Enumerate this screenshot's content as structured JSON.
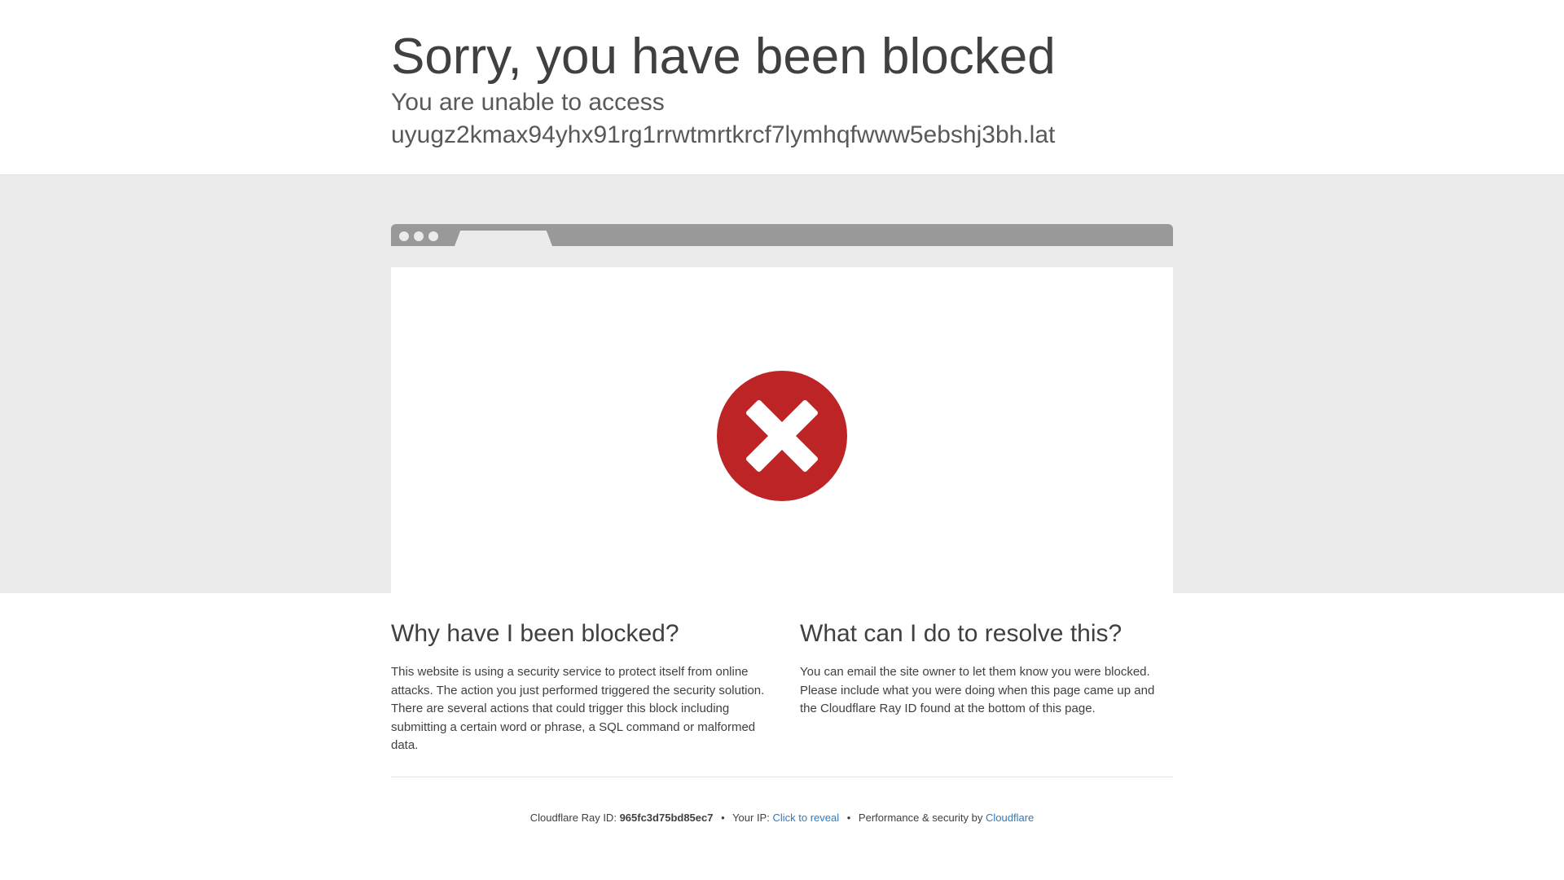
{
  "header": {
    "title": "Sorry, you have been blocked",
    "subtitle_line1": "You are unable to access",
    "subtitle_line2": "uyugz2kmax94yhx91rg1rrwtmrtkrcf7lymhqfwww5ebshj3bh.lat"
  },
  "illustration": {
    "icon": "blocked-x-icon",
    "icon_color": "#bd2426"
  },
  "why": {
    "heading": "Why have I been blocked?",
    "body": "This website is using a security service to protect itself from online attacks. The action you just performed triggered the security solution. There are several actions that could trigger this block including submitting a certain word or phrase, a SQL command or malformed data."
  },
  "resolve": {
    "heading": "What can I do to resolve this?",
    "body": "You can email the site owner to let them know you were blocked. Please include what you were doing when this page came up and the Cloudflare Ray ID found at the bottom of this page."
  },
  "footer": {
    "ray_label": "Cloudflare Ray ID:",
    "ray_id": "965fc3d75bd85ec7",
    "separator": "•",
    "ip_label": "Your IP:",
    "ip_link": "Click to reveal",
    "perf_label": "Performance & security by",
    "brand_link": "Cloudflare",
    "link_color": "#2f7bbf"
  }
}
